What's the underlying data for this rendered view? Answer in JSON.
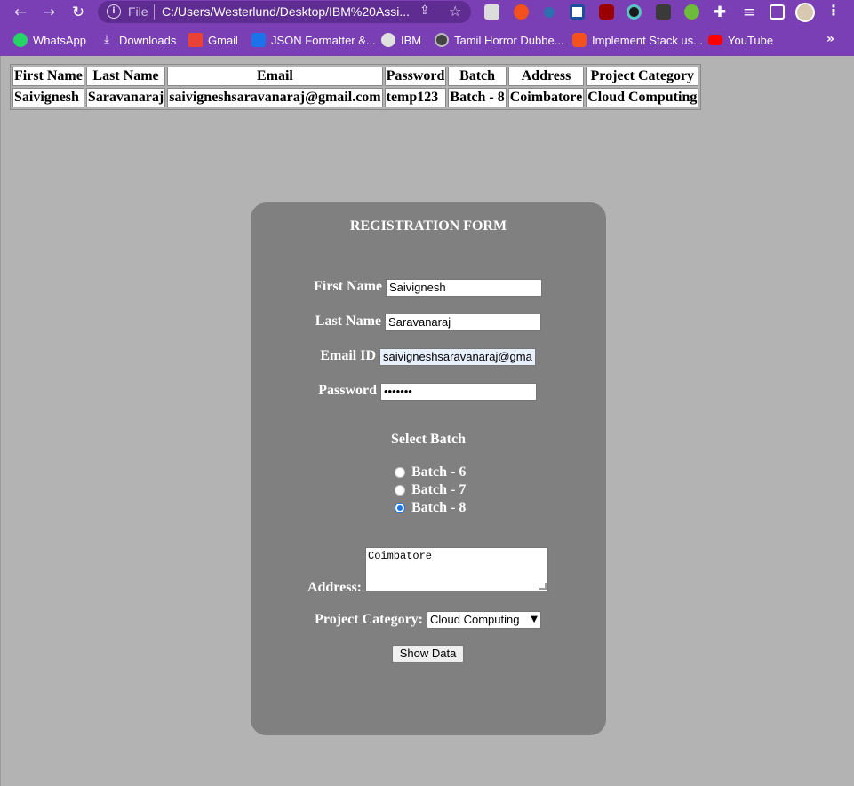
{
  "browser": {
    "omnibox": {
      "scheme_label": "File",
      "url": "C:/Users/Westerlund/Desktop/IBM%20Assi..."
    },
    "nav": {
      "back_icon": "arrow-left-icon",
      "forward_icon": "arrow-right-icon",
      "reload_icon": "reload-icon"
    },
    "bookmarks": [
      {
        "label": "WhatsApp",
        "icon": "whatsapp-icon",
        "color": "#25d366"
      },
      {
        "label": "Downloads",
        "icon": "download-icon",
        "color": "#ffffff"
      },
      {
        "label": "Gmail",
        "icon": "gmail-icon",
        "color": "#ea4335"
      },
      {
        "label": "JSON Formatter &...",
        "icon": "json-formatter-icon",
        "color": "#1a73e8"
      },
      {
        "label": "IBM",
        "icon": "globe-icon",
        "color": "#e0e0e0"
      },
      {
        "label": "Tamil Horror Dubbe...",
        "icon": "tamil-horror-icon",
        "color": "#444444"
      },
      {
        "label": "Implement Stack us...",
        "icon": "stack-icon",
        "color": "#f4511e"
      },
      {
        "label": "YouTube",
        "icon": "youtube-icon",
        "color": "#ff0000"
      }
    ],
    "accent_color": "#7b3fb5"
  },
  "table": {
    "headers": [
      "First Name",
      "Last Name",
      "Email",
      "Password",
      "Batch",
      "Address",
      "Project Category"
    ],
    "rows": [
      [
        "Saivignesh",
        "Saravanaraj",
        "saivigneshsaravanaraj@gmail.com",
        "temp123",
        "Batch - 8",
        "Coimbatore",
        "Cloud Computing"
      ]
    ]
  },
  "form": {
    "title": "REGISTRATION FORM",
    "first_name": {
      "label": "First Name",
      "value": "Saivignesh"
    },
    "last_name": {
      "label": "Last Name",
      "value": "Saravanaraj"
    },
    "email": {
      "label": "Email ID",
      "value": "saivigneshsaravanaraj@gma"
    },
    "password": {
      "label": "Password",
      "value": "•••••••"
    },
    "batch": {
      "title": "Select Batch",
      "options": [
        "Batch - 6",
        "Batch - 7",
        "Batch - 8"
      ],
      "selected": "Batch - 8"
    },
    "address": {
      "label": "Address:",
      "value": "Coimbatore"
    },
    "project_category": {
      "label": "Project Category:",
      "selected": "Cloud Computing"
    },
    "submit_label": "Show Data",
    "card_color": "#808080",
    "page_color": "#b3b3b3"
  }
}
